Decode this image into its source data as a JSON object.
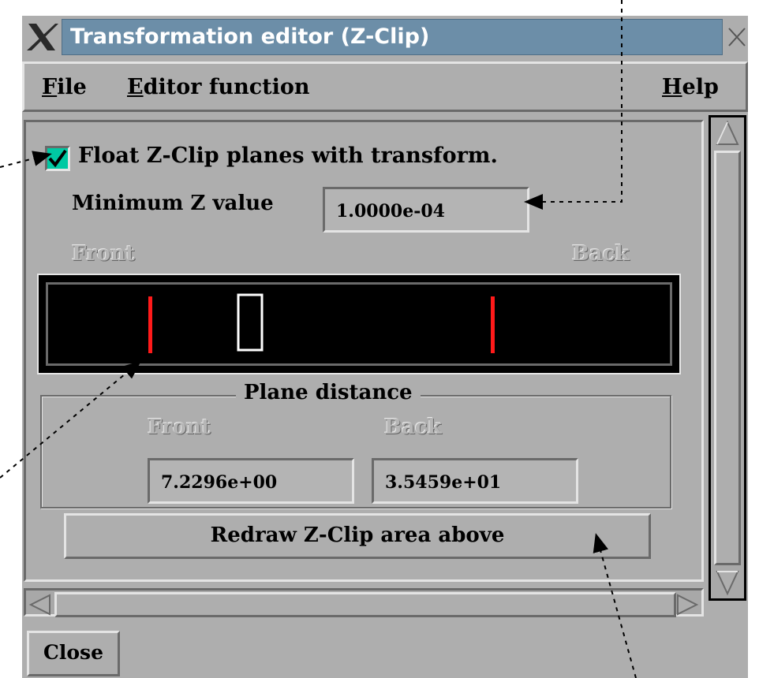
{
  "window": {
    "title": "Transformation editor (Z-Clip)"
  },
  "menu": {
    "file_mn": "F",
    "file_rest": "ile",
    "editor_mn": "E",
    "editor_rest": "ditor function",
    "help_mn": "H",
    "help_rest": "elp"
  },
  "options": {
    "float_label": "Float Z-Clip planes with transform.",
    "float_checked": true
  },
  "min_z": {
    "label": "Minimum Z value",
    "value": "1.0000e-04"
  },
  "zclip": {
    "front_label": "Front",
    "back_label": "Back"
  },
  "plane_distance": {
    "title": "Plane distance",
    "front_label": "Front",
    "back_label": "Back",
    "front_value": "7.2296e+00",
    "back_value": "3.5459e+01"
  },
  "buttons": {
    "redraw": "Redraw Z-Clip area above",
    "close": "Close"
  },
  "colors": {
    "titlebar": "#6c8ea8",
    "checkbox": "#00c9a3",
    "clip_plane": "#ff1a1a",
    "canvas": "#000000",
    "window": "#aeaeae"
  }
}
